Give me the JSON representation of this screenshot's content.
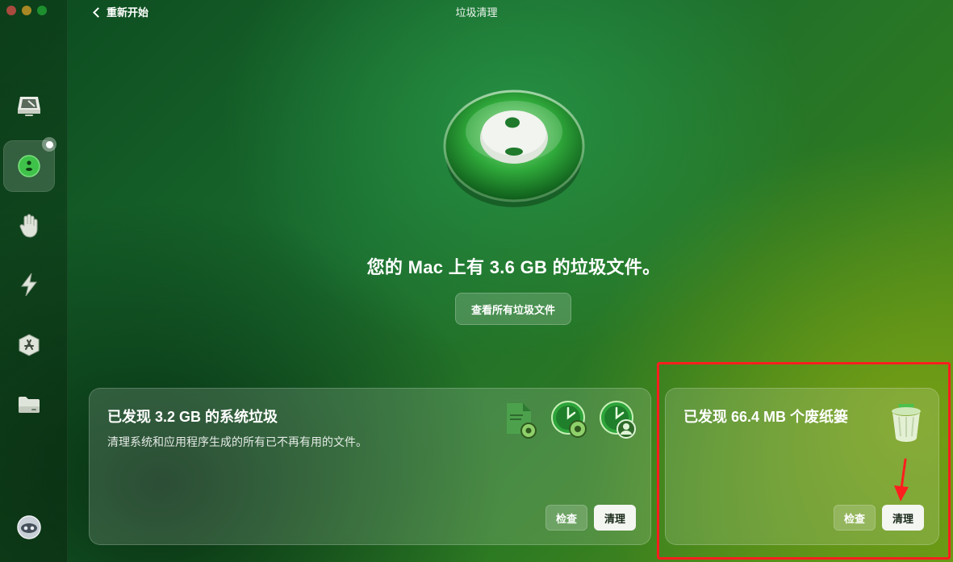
{
  "window": {
    "title": "垃圾清理",
    "back_label": "重新开始"
  },
  "sidebar": {
    "items": [
      {
        "icon": "disk-icon"
      },
      {
        "icon": "cleanup-icon",
        "active": true
      },
      {
        "icon": "hand-icon"
      },
      {
        "icon": "bolt-icon"
      },
      {
        "icon": "app-store-icon"
      },
      {
        "icon": "folder-icon"
      }
    ],
    "bottom_icon": "assistant-icon"
  },
  "hero": {
    "headline": "您的 Mac 上有 3.6 GB 的垃圾文件。",
    "view_all_label": "查看所有垃圾文件"
  },
  "cards": {
    "system": {
      "title": "已发现 3.2 GB 的系统垃圾",
      "description": "清理系统和应用程序生成的所有已不再有用的文件。",
      "inspect_label": "检查",
      "clean_label": "清理",
      "icons": [
        "document-gear-icon",
        "clock-gear-icon",
        "clock-user-icon"
      ]
    },
    "trash": {
      "title": "已发现 66.4 MB 个废纸篓",
      "inspect_label": "检查",
      "clean_label": "清理",
      "icon": "trash-bin-icon"
    }
  },
  "colors": {
    "annotation": "#ff1e1e",
    "accent_green": "#3fc24a"
  }
}
